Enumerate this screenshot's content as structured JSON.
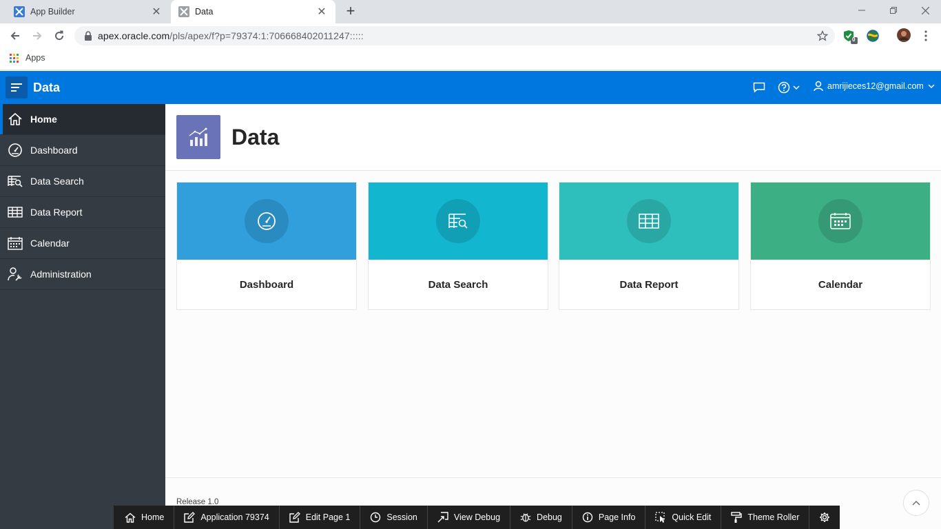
{
  "browser": {
    "tabs": [
      {
        "title": "App Builder"
      },
      {
        "title": "Data"
      }
    ],
    "url_host": "apex.oracle.com",
    "url_path": "/pls/apex/f?p=79374:1:706668402011247:::::",
    "bookmarks": {
      "apps_label": "Apps"
    },
    "extension_badge": "0"
  },
  "app": {
    "name": "Data",
    "user": "amrijieces12@gmail.com"
  },
  "sidebar": {
    "items": [
      {
        "label": "Home"
      },
      {
        "label": "Dashboard"
      },
      {
        "label": "Data Search"
      },
      {
        "label": "Data Report"
      },
      {
        "label": "Calendar"
      },
      {
        "label": "Administration"
      }
    ]
  },
  "page": {
    "title": "Data",
    "cards": [
      {
        "label": "Dashboard",
        "color": "#309fdb"
      },
      {
        "label": "Data Search",
        "color": "#13b6cf"
      },
      {
        "label": "Data Report",
        "color": "#2ebfbc"
      },
      {
        "label": "Calendar",
        "color": "#3caf85"
      }
    ],
    "release": "Release 1.0"
  },
  "devbar": {
    "items": [
      {
        "label": "Home"
      },
      {
        "label": "Application 79374"
      },
      {
        "label": "Edit Page 1"
      },
      {
        "label": "Session"
      },
      {
        "label": "View Debug"
      },
      {
        "label": "Debug"
      },
      {
        "label": "Page Info"
      },
      {
        "label": "Quick Edit"
      },
      {
        "label": "Theme Roller"
      }
    ]
  },
  "colors": {
    "header": "#0076df",
    "sidebar": "#343b43",
    "hero_icon": "#6b73b8"
  }
}
